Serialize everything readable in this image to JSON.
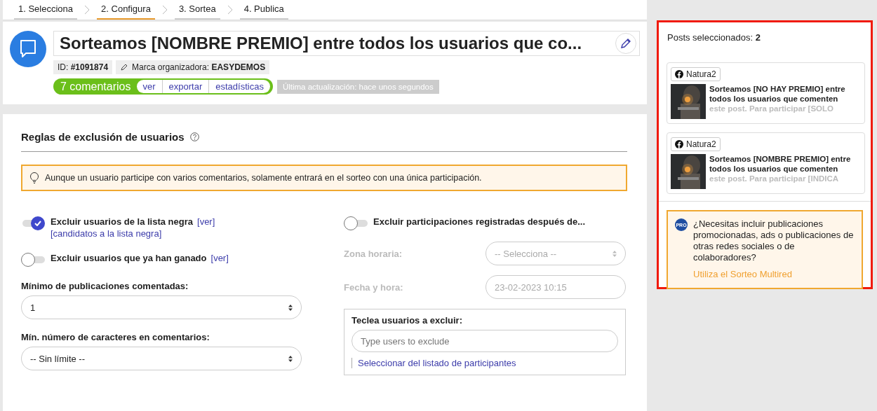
{
  "steps": [
    {
      "label": "1. Selecciona",
      "selected": false
    },
    {
      "label": "2. Configura",
      "selected": true
    },
    {
      "label": "3. Sortea",
      "selected": false
    },
    {
      "label": "4. Publica",
      "selected": false
    }
  ],
  "header": {
    "title": "Sorteamos [NOMBRE PREMIO] entre todos los usuarios que co...",
    "id_label": "ID: **#1091874**",
    "brand_label": "Marca organizadora: **EASYDEMOS**",
    "comments": "7 comentarios",
    "comment_links": [
      "ver",
      "exportar",
      "estadísticas"
    ],
    "updated": "Última actualización: hace unos segundos"
  },
  "rules": {
    "title": "Reglas de exclusión de usuarios",
    "notice": "Aunque un usuario participe con varios comentarios, solamente entrará en el sorteo con una única participación.",
    "left_toggles": [
      {
        "label": "Excluir usuarios de la lista negra",
        "on": true,
        "link": "[ver]",
        "sublink": "[candidatos a la lista negra]"
      },
      {
        "label": "Excluir usuarios que ya han ganado",
        "on": false,
        "link": "[ver]"
      }
    ],
    "selects": [
      {
        "label": "Mínimo de publicaciones comentadas:",
        "value": "1"
      },
      {
        "label": "Mín. número de caracteres en comentarios:",
        "value": "-- Sin límite --"
      }
    ],
    "date_toggle": {
      "label": "Excluir participaciones registradas después de...",
      "on": false
    },
    "date_fields": [
      {
        "kind": "select",
        "label": "Zona horaria:",
        "value": "-- Selecciona --",
        "disabled": true
      },
      {
        "kind": "input",
        "label": "Fecha y hora:",
        "value": "23-02-2023 10:15",
        "disabled": true
      }
    ],
    "exclude_box": {
      "label": "Teclea usuarios a excluir:",
      "placeholder": "Type users to exclude",
      "link": "Seleccionar del listado de participantes"
    }
  },
  "sidebar": {
    "count_label": "Posts seleccionados: **2**",
    "posts": [
      {
        "page": "Natura2",
        "title": "Sorteamos [NO HAY PREMIO] entre todos los usuarios que comenten",
        "excerpt": "este post. Para participar [SOLO"
      },
      {
        "page": "Natura2",
        "title": "Sorteamos [NOMBRE PREMIO] entre todos los usuarios que comenten",
        "excerpt": "este post. Para participar [INDICA"
      }
    ],
    "promo": {
      "badge": "PRO",
      "text": "¿Necesitas incluir publicaciones promocionadas, ads o publicaciones de otras redes sociales o de colaboradores?",
      "link": "Utiliza el Sorteo Multired"
    }
  }
}
